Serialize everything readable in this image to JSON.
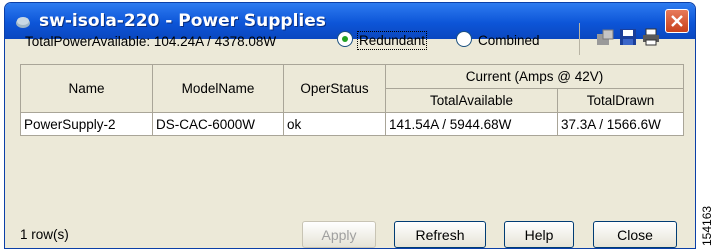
{
  "window": {
    "title": "sw-isola-220 - Power Supplies"
  },
  "toolbar": {
    "power_available": "TotalPowerAvailable: 104.24A / 4378.08W",
    "mode_options": [
      {
        "label": "Redundant",
        "selected": true
      },
      {
        "label": "Combined",
        "selected": false
      }
    ],
    "icons": [
      "export-icon",
      "save-icon",
      "print-icon"
    ]
  },
  "table": {
    "headers": {
      "name": "Name",
      "model": "ModelName",
      "status": "OperStatus",
      "current_group": "Current (Amps @ 42V)",
      "total_available": "TotalAvailable",
      "total_drawn": "TotalDrawn"
    },
    "rows": [
      [
        "PowerSupply-2",
        "DS-CAC-6000W",
        "ok",
        "141.54A / 5944.68W",
        "37.3A / 1566.6W"
      ]
    ]
  },
  "buttons": {
    "apply": "Apply",
    "refresh": "Refresh",
    "help": "Help",
    "close": "Close"
  },
  "status": {
    "row_count": "1 row(s)"
  },
  "figure_id": "154163"
}
